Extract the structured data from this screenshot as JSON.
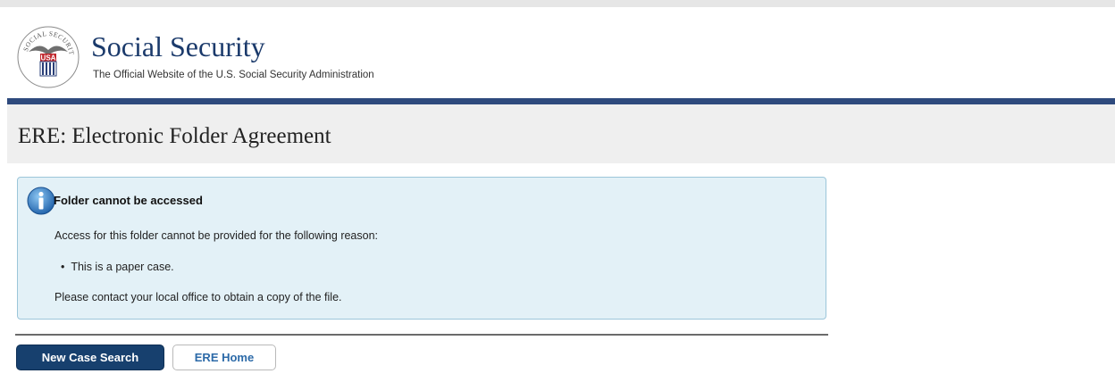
{
  "header": {
    "logo_icon": "ssa-seal-icon",
    "seal_top_text": "SOCIAL SECURITY",
    "seal_center_text": "USA",
    "site_title": "Social Security",
    "site_subtitle": "The Official Website of the U.S. Social Security Administration"
  },
  "page": {
    "title": "ERE: Electronic Folder Agreement"
  },
  "alert": {
    "icon": "info-icon",
    "heading": "Folder cannot be accessed",
    "message": "Access for this folder cannot be provided for the following reason:",
    "reasons": [
      "This is a paper case."
    ],
    "instruction": "Please contact your local office to obtain a copy of the file."
  },
  "actions": {
    "new_case_search_label": "New Case Search",
    "ere_home_label": "ERE Home"
  },
  "colors": {
    "brand_navy": "#1b3a6b",
    "header_rule": "#2e4a7d",
    "alert_background": "#e3f1f7",
    "primary_button": "#17406e",
    "link_blue": "#2c6aa8"
  }
}
